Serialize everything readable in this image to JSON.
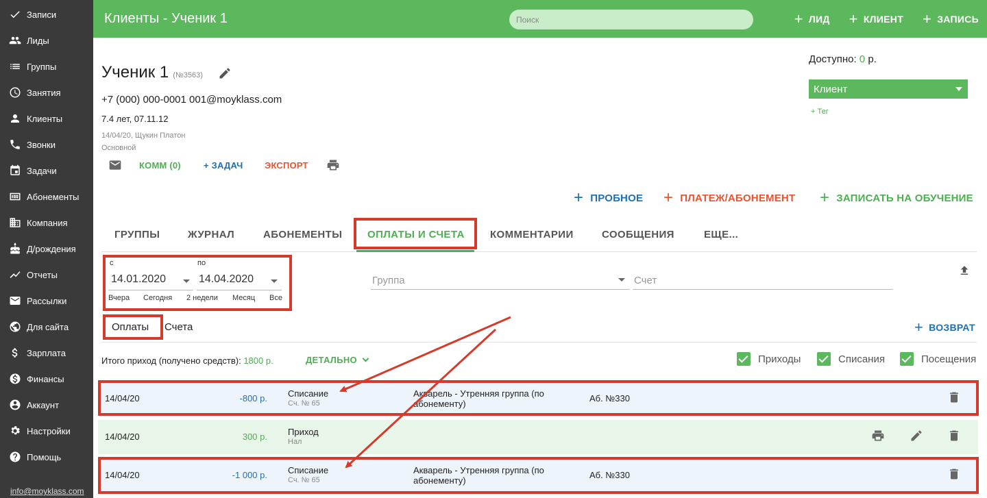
{
  "sidebar": {
    "items": [
      {
        "label": "Записи",
        "icon": "check-icon"
      },
      {
        "label": "Лиды",
        "icon": "people-icon"
      },
      {
        "label": "Группы",
        "icon": "list-icon"
      },
      {
        "label": "Занятия",
        "icon": "clock-icon"
      },
      {
        "label": "Клиенты",
        "icon": "person-icon"
      },
      {
        "label": "Звонки",
        "icon": "phone-icon"
      },
      {
        "label": "Задачи",
        "icon": "calendar-icon"
      },
      {
        "label": "Абонементы",
        "icon": "hundred-icon"
      },
      {
        "label": "Компания",
        "icon": "building-icon"
      },
      {
        "label": "Д/рождения",
        "icon": "cake-icon"
      },
      {
        "label": "Отчеты",
        "icon": "chart-line-icon"
      },
      {
        "label": "Рассылки",
        "icon": "mail-icon"
      },
      {
        "label": "Для сайта",
        "icon": "globe-icon"
      },
      {
        "label": "Зарплата",
        "icon": "dollar-icon"
      },
      {
        "label": "Финансы",
        "icon": "money-circle-icon"
      },
      {
        "label": "Аккаунт",
        "icon": "account-icon"
      },
      {
        "label": "Настройки",
        "icon": "gear-icon"
      },
      {
        "label": "Помощь",
        "icon": "help-icon"
      }
    ],
    "footer_email": "info@moyklass.com"
  },
  "header": {
    "title": "Клиенты - Ученик 1",
    "search_placeholder": "Поиск",
    "actions": [
      "ЛИД",
      "КЛИЕНТ",
      "ЗАПИСЬ"
    ]
  },
  "profile": {
    "name": "Ученик 1",
    "id": "(№3563)",
    "contacts": "+7 (000) 000-0001 001@moyklass.com",
    "age": "7.4 лет, 07.11.12",
    "meta1": "14/04/20, Щукин Платон",
    "meta2": "Основной",
    "comm": "КОММ (0)",
    "task": "+ ЗАДАЧ",
    "export": "ЭКСПОРТ"
  },
  "side_panel": {
    "available_label": "Доступно:",
    "available_value": "0",
    "available_unit": "р.",
    "status": "Клиент",
    "tag": "+ Тег"
  },
  "actions": {
    "trial": "ПРОБНОЕ",
    "payment": "ПЛАТЕЖ/АБОНЕМЕНТ",
    "enroll": "ЗАПИСАТЬ НА ОБУЧЕНИЕ"
  },
  "tabs": [
    "ГРУППЫ",
    "ЖУРНАЛ",
    "АБОНЕМЕНТЫ",
    "ОПЛАТЫ И СЧЕТА",
    "КОММЕНТАРИИ",
    "СООБЩЕНИЯ",
    "ЕЩЕ..."
  ],
  "filter": {
    "from_label": "с",
    "to_label": "по",
    "from": "14.01.2020",
    "to": "14.04.2020",
    "quick": [
      "Вчера",
      "Сегодня",
      "2 недели",
      "Месяц",
      "Все"
    ],
    "group_placeholder": "Группа",
    "invoice_placeholder": "Счет"
  },
  "subtabs": [
    "Оплаты",
    "Счета"
  ],
  "refund": "ВОЗВРАТ",
  "summary": {
    "label": "Итого приход (получено средств):",
    "value": "1800 р.",
    "detail": "ДЕТАЛЬНО"
  },
  "checkboxes": [
    "Приходы",
    "Списания",
    "Посещения"
  ],
  "rows": [
    {
      "date": "14/04/20",
      "amount": "-800 р.",
      "type": "Списание",
      "sub": "Сч. № 65",
      "group": "Акварель - Утренняя группа (по",
      "group2": "абонементу)",
      "sub_no": "Аб. №330"
    },
    {
      "date": "14/04/20",
      "amount": "300 р.",
      "type": "Приход",
      "sub": "Нал",
      "group": "",
      "group2": "",
      "sub_no": ""
    },
    {
      "date": "14/04/20",
      "amount": "-1 000 р.",
      "type": "Списание",
      "sub": "Сч. № 65",
      "group": "Акварель - Утренняя группа (по",
      "group2": "абонементу)",
      "sub_no": "Аб. №330"
    }
  ],
  "colors": {
    "brand_green": "#5cb85c",
    "sidebar": "#3a3a3a",
    "highlight_red": "#d63a2a",
    "blue": "#1e6fb5",
    "orange_red": "#e8542f"
  }
}
